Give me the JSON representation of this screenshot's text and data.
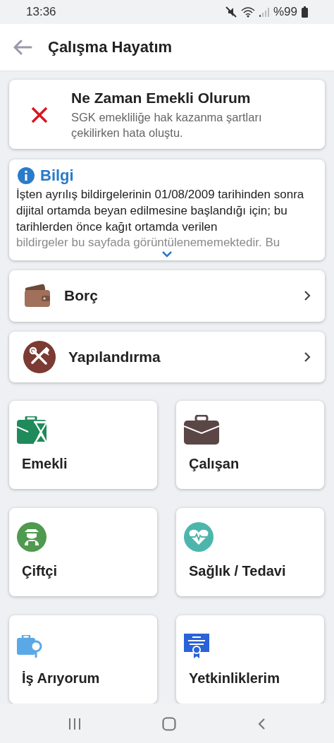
{
  "status_bar": {
    "time": "13:36",
    "battery": "%99"
  },
  "app_bar": {
    "title": "Çalışma Hayatım"
  },
  "error_card": {
    "title": "Ne Zaman Emekli Olurum",
    "message": "SGK emekliliğe hak kazanma şartları çekilirken hata oluştu."
  },
  "info_card": {
    "title": "Bilgi",
    "text": "İşten ayrılış bildirgelerinin 01/08/2009 tarihinden sonra dijital ortamda beyan edilmesine başlandığı için; bu tarihlerden önce kağıt ortamda verilen",
    "faded_text": "bildirgeler bu sayfada görüntülenememektedir. Bu"
  },
  "menu_items": [
    {
      "label": "Borç"
    },
    {
      "label": "Yapılandırma"
    }
  ],
  "tiles": [
    {
      "label": "Emekli"
    },
    {
      "label": "Çalışan"
    },
    {
      "label": "Çiftçi"
    },
    {
      "label": "Sağlık / Tedavi"
    },
    {
      "label": "İş Arıyorum"
    },
    {
      "label": "Yetkinliklerim"
    }
  ]
}
